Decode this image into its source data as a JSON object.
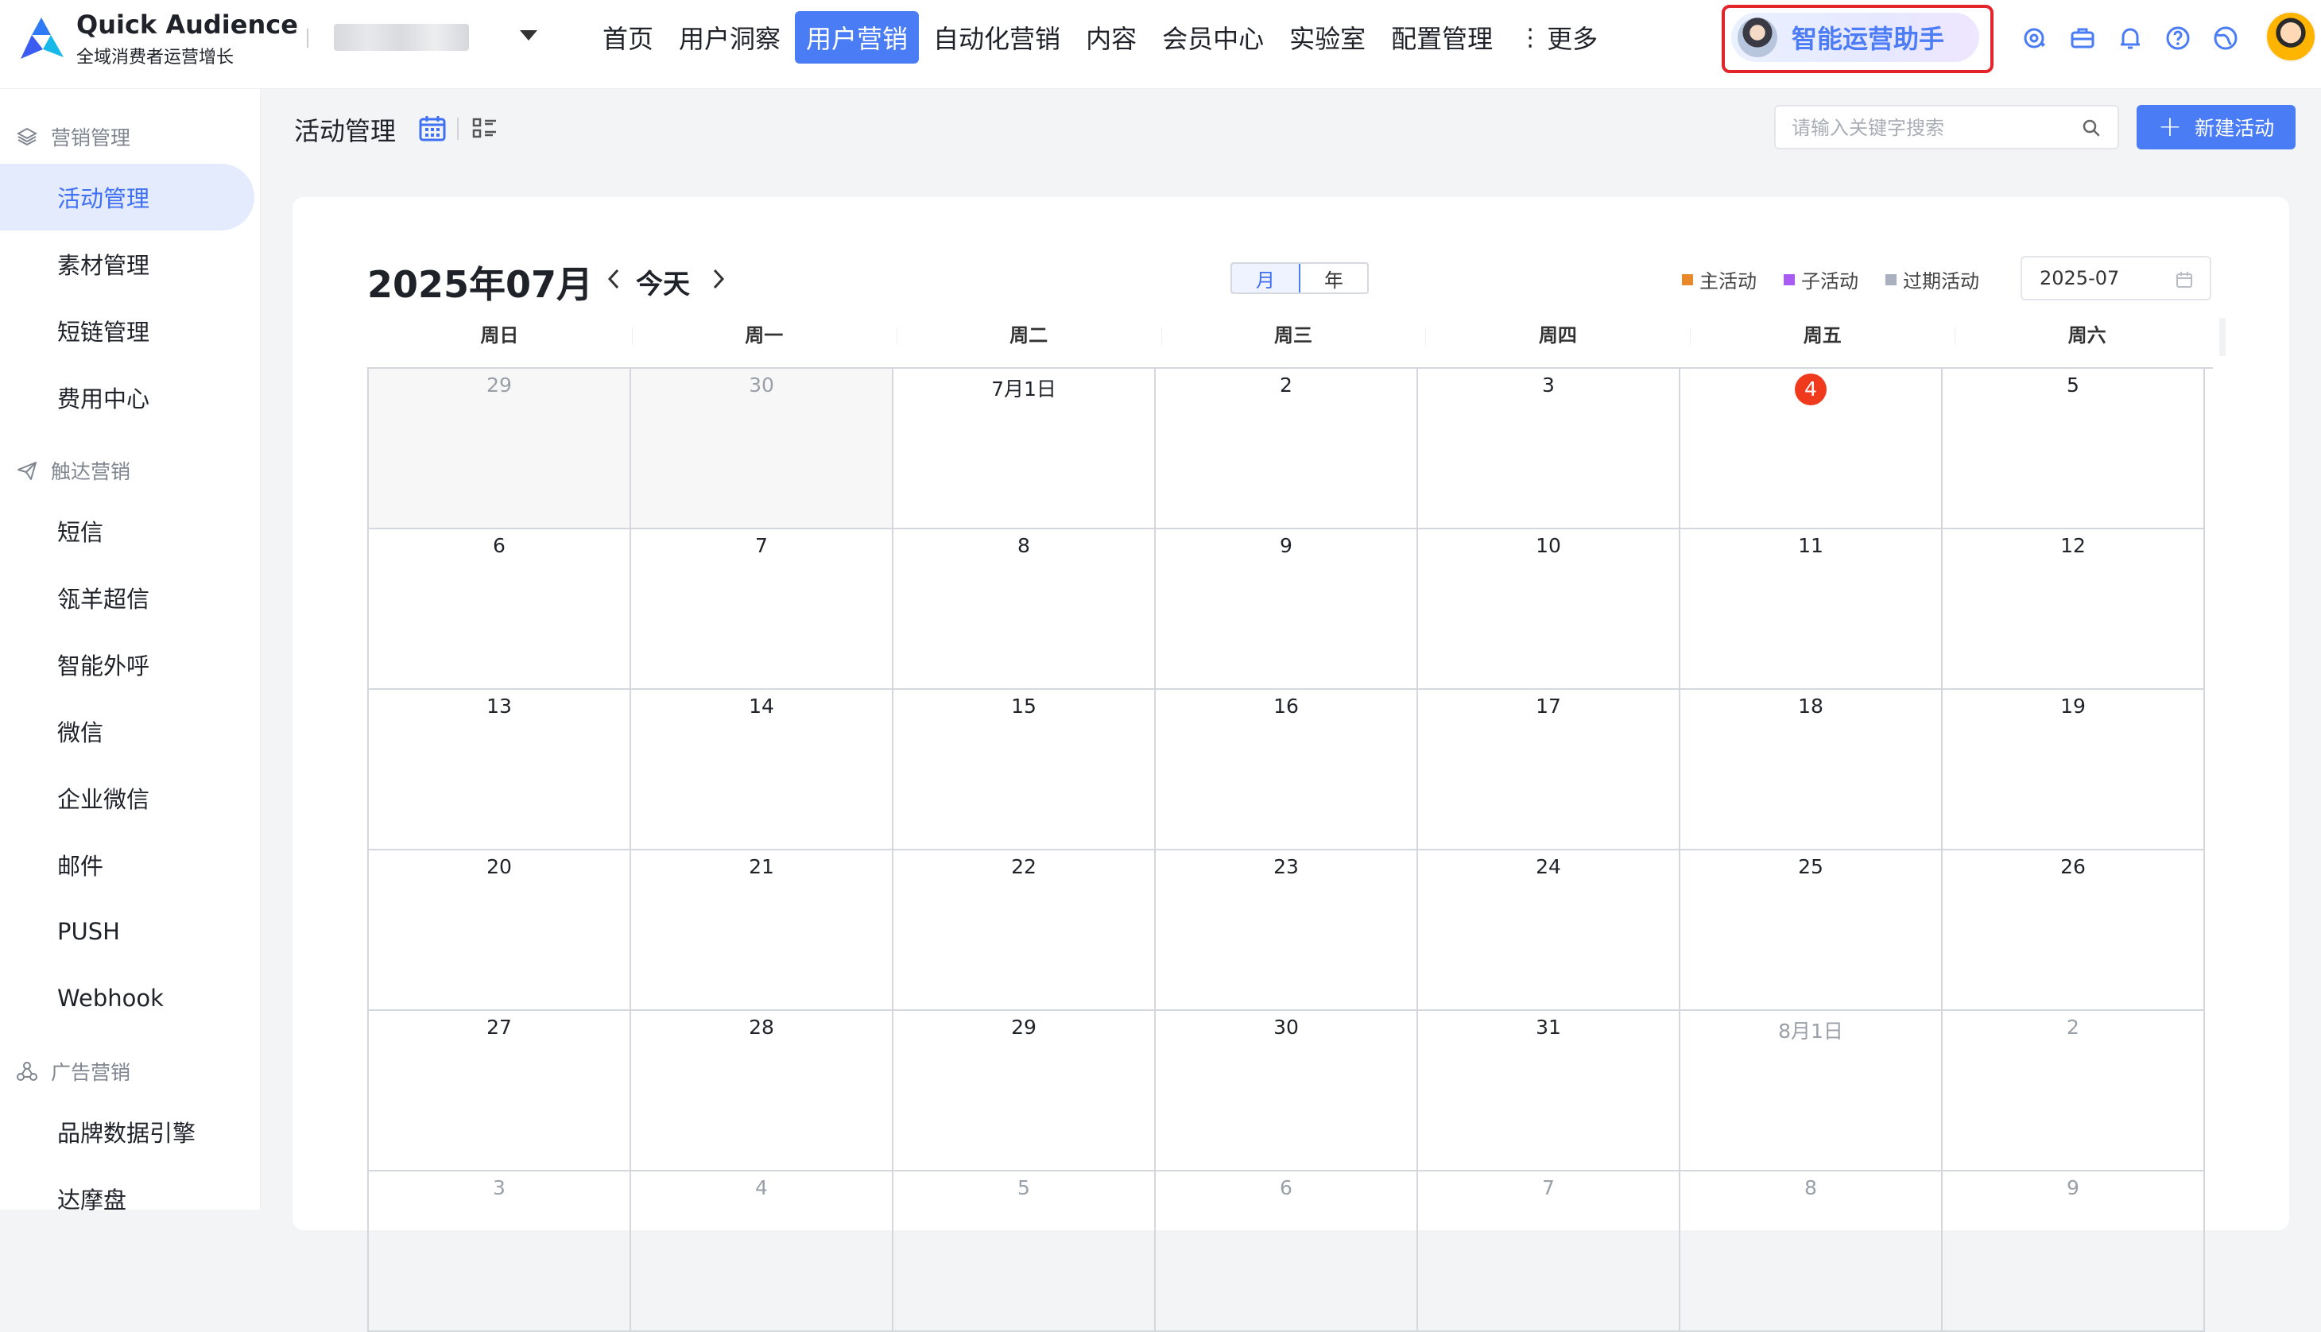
{
  "brand": {
    "name": "Quick Audience",
    "subtitle": "全域消费者运营增长"
  },
  "nav": {
    "items": [
      {
        "label": "首页",
        "active": false
      },
      {
        "label": "用户洞察",
        "active": false
      },
      {
        "label": "用户营销",
        "active": true
      },
      {
        "label": "自动化营销",
        "active": false
      },
      {
        "label": "内容",
        "active": false
      },
      {
        "label": "会员中心",
        "active": false
      },
      {
        "label": "实验室",
        "active": false
      },
      {
        "label": "配置管理",
        "active": false
      }
    ],
    "more_label": "更多"
  },
  "assistant": {
    "label": "智能运营助手"
  },
  "top_icons": [
    "sparkle-gear-icon",
    "briefcase-icon",
    "bell-icon",
    "help-icon",
    "globe-icon"
  ],
  "sidebar": {
    "groups": [
      {
        "label": "营销管理",
        "icon": "layers-icon",
        "items": [
          "活动管理",
          "素材管理",
          "短链管理",
          "费用中心"
        ]
      },
      {
        "label": "触达营销",
        "icon": "paper-plane-icon",
        "items": [
          "短信",
          "瓴羊超信",
          "智能外呼",
          "微信",
          "企业微信",
          "邮件",
          "PUSH",
          "Webhook"
        ]
      },
      {
        "label": "广告营销",
        "icon": "nodes-icon",
        "items": [
          "品牌数据引擎",
          "达摩盘"
        ]
      }
    ],
    "active_item": "活动管理"
  },
  "page": {
    "title": "活动管理",
    "search_placeholder": "请输入关键字搜索",
    "new_button_label": "新建活动"
  },
  "calendar": {
    "title": "2025年07月",
    "today_label": "今天",
    "modes": [
      {
        "label": "月",
        "active": true
      },
      {
        "label": "年",
        "active": false
      }
    ],
    "legend": [
      {
        "label": "主活动",
        "color": "#e8892b"
      },
      {
        "label": "子活动",
        "color": "#a85cf2"
      },
      {
        "label": "过期活动",
        "color": "#a9b0c0"
      }
    ],
    "month_picker_value": "2025-07",
    "weekdays": [
      "周日",
      "周一",
      "周二",
      "周三",
      "周四",
      "周五",
      "周六"
    ],
    "weeks": [
      [
        {
          "d": "29",
          "other": true,
          "shaded": true
        },
        {
          "d": "30",
          "other": true,
          "shaded": true
        },
        {
          "d": "7月1日"
        },
        {
          "d": "2"
        },
        {
          "d": "3"
        },
        {
          "d": "4",
          "today": true
        },
        {
          "d": "5"
        }
      ],
      [
        {
          "d": "6"
        },
        {
          "d": "7"
        },
        {
          "d": "8"
        },
        {
          "d": "9"
        },
        {
          "d": "10"
        },
        {
          "d": "11"
        },
        {
          "d": "12"
        }
      ],
      [
        {
          "d": "13"
        },
        {
          "d": "14"
        },
        {
          "d": "15"
        },
        {
          "d": "16"
        },
        {
          "d": "17"
        },
        {
          "d": "18"
        },
        {
          "d": "19"
        }
      ],
      [
        {
          "d": "20"
        },
        {
          "d": "21"
        },
        {
          "d": "22"
        },
        {
          "d": "23"
        },
        {
          "d": "24"
        },
        {
          "d": "25"
        },
        {
          "d": "26"
        }
      ],
      [
        {
          "d": "27"
        },
        {
          "d": "28"
        },
        {
          "d": "29"
        },
        {
          "d": "30"
        },
        {
          "d": "31"
        },
        {
          "d": "8月1日",
          "other": true
        },
        {
          "d": "2",
          "other": true
        }
      ],
      [
        {
          "d": "3",
          "other": true
        },
        {
          "d": "4",
          "other": true
        },
        {
          "d": "5",
          "other": true
        },
        {
          "d": "6",
          "other": true
        },
        {
          "d": "7",
          "other": true
        },
        {
          "d": "8",
          "other": true
        },
        {
          "d": "9",
          "other": true
        }
      ]
    ]
  },
  "colors": {
    "accent": "#4a7cf6",
    "today_badge": "#ef3a1d",
    "highlight_frame": "#e3242b"
  }
}
